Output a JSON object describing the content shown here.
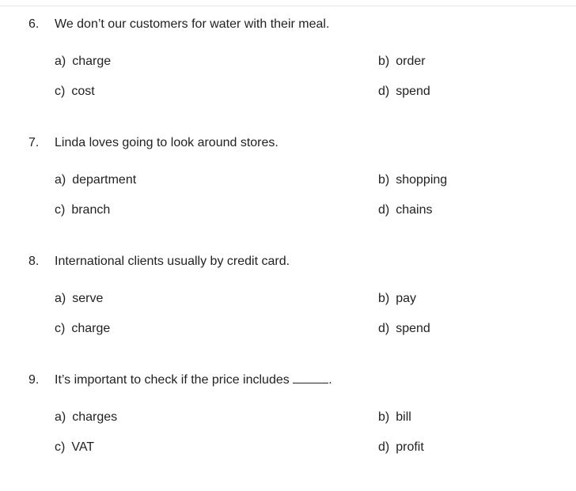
{
  "questions": [
    {
      "number": "6.",
      "text": "We don’t our customers for water with their meal.",
      "options": [
        {
          "letter": "a)",
          "text": "charge"
        },
        {
          "letter": "b)",
          "text": "order"
        },
        {
          "letter": "c)",
          "text": "cost"
        },
        {
          "letter": "d)",
          "text": "spend"
        }
      ]
    },
    {
      "number": "7.",
      "text": "Linda loves going to look around stores.",
      "options": [
        {
          "letter": "a)",
          "text": "department"
        },
        {
          "letter": "b)",
          "text": "shopping"
        },
        {
          "letter": "c)",
          "text": "branch"
        },
        {
          "letter": "d)",
          "text": "chains"
        }
      ]
    },
    {
      "number": "8.",
      "text": "International clients usually by credit card.",
      "options": [
        {
          "letter": "a)",
          "text": "serve"
        },
        {
          "letter": "b)",
          "text": "pay"
        },
        {
          "letter": "c)",
          "text": "charge"
        },
        {
          "letter": "d)",
          "text": "spend"
        }
      ]
    },
    {
      "number": "9.",
      "text": "It’s important to check if the price includes",
      "text_end": ".",
      "options": [
        {
          "letter": "a)",
          "text": "charges"
        },
        {
          "letter": "b)",
          "text": "bill"
        },
        {
          "letter": "c)",
          "text": "VAT"
        },
        {
          "letter": "d)",
          "text": "profit"
        }
      ]
    }
  ]
}
